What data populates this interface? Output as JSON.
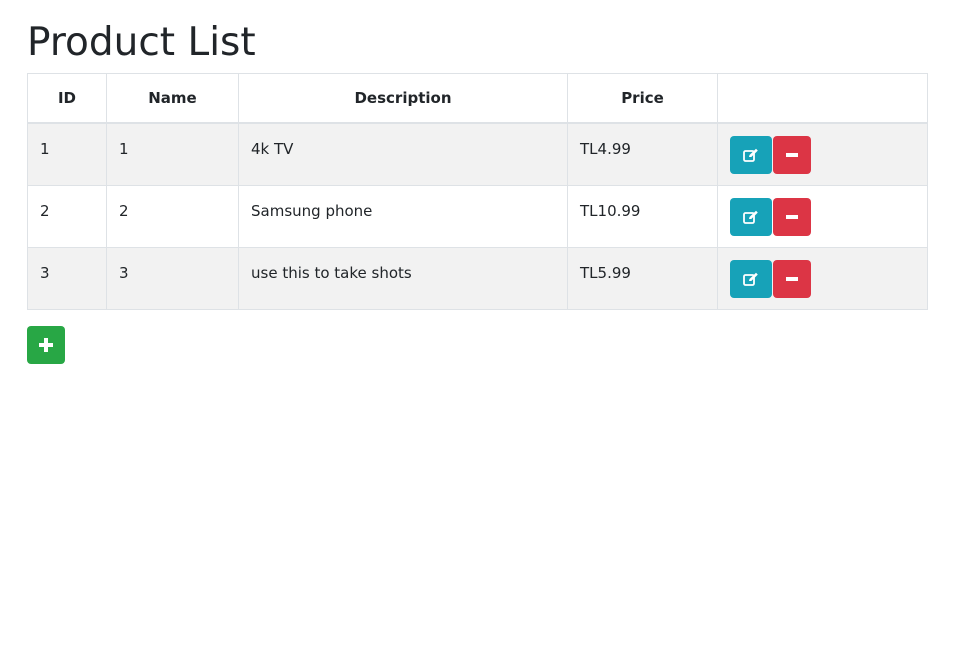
{
  "page": {
    "title": "Product List"
  },
  "table": {
    "headers": [
      "ID",
      "Name",
      "Description",
      "Price",
      ""
    ],
    "rows": [
      {
        "id": "1",
        "name": "1",
        "description": "4k TV",
        "price": "TL4.99"
      },
      {
        "id": "2",
        "name": "2",
        "description": "Samsung phone",
        "price": "TL10.99"
      },
      {
        "id": "3",
        "name": "3",
        "description": "use this to take shots",
        "price": "TL5.99"
      }
    ]
  },
  "icons": {
    "edit": "edit-icon",
    "delete": "minus-icon",
    "add": "plus-icon"
  },
  "colors": {
    "edit_button": "#17a2b8",
    "delete_button": "#dc3545",
    "add_button": "#28a745",
    "striped_row": "#f2f2f2"
  }
}
